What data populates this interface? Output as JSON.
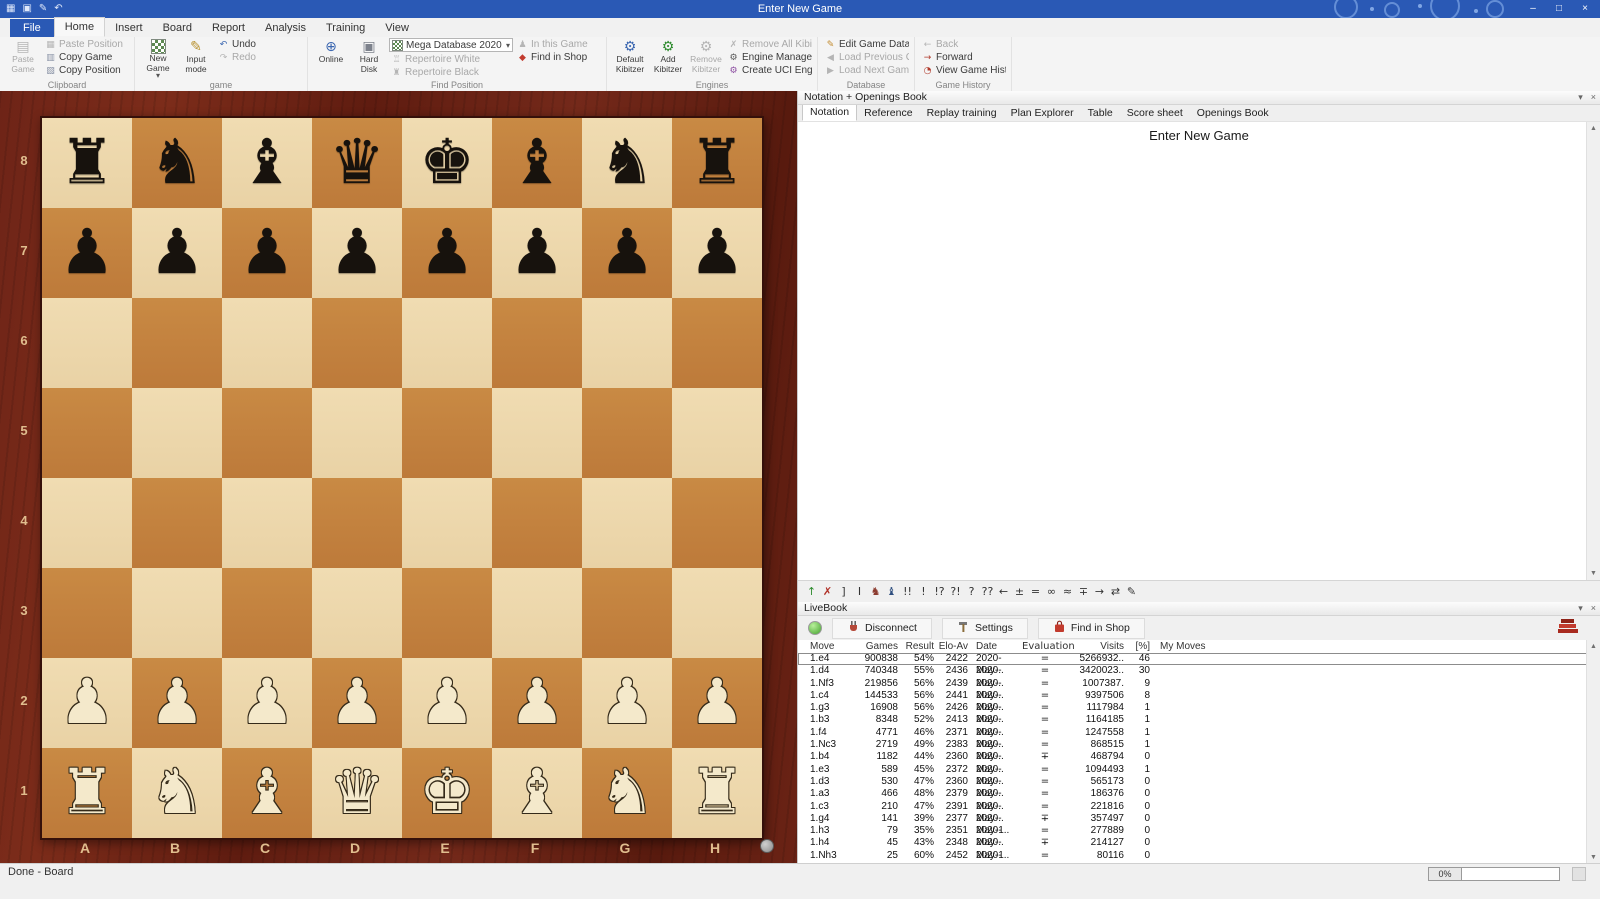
{
  "titlebar": {
    "title": "Enter New Game",
    "quick_access": [
      {
        "name": "board",
        "glyph": "▦"
      },
      {
        "name": "save",
        "glyph": "▣"
      },
      {
        "name": "edit",
        "glyph": "✎"
      },
      {
        "name": "undo",
        "glyph": "↶"
      }
    ],
    "window_buttons": [
      {
        "name": "minimize",
        "glyph": "–"
      },
      {
        "name": "maximize",
        "glyph": "□"
      },
      {
        "name": "close",
        "glyph": "×"
      }
    ]
  },
  "menu": {
    "tabs": [
      {
        "label": "File",
        "style": "file"
      },
      {
        "label": "Home",
        "style": "active"
      },
      {
        "label": "Insert"
      },
      {
        "label": "Board"
      },
      {
        "label": "Report"
      },
      {
        "label": "Analysis"
      },
      {
        "label": "Training"
      },
      {
        "label": "View"
      }
    ]
  },
  "ribbon": {
    "groups": [
      {
        "name": "Clipboard",
        "cols": [
          {
            "type": "big",
            "items": [
              {
                "label": "Paste Game",
                "icon": "clipboard",
                "disabled": true
              }
            ]
          },
          {
            "type": "small",
            "items": [
              {
                "label": "Paste Position",
                "icon": "paste-position",
                "disabled": true
              },
              {
                "label": "Copy Game",
                "icon": "copy-game"
              },
              {
                "label": "Copy Position",
                "icon": "copy-position"
              }
            ]
          }
        ]
      },
      {
        "name": "game",
        "cols": [
          {
            "type": "big",
            "items": [
              {
                "label": "New Game",
                "icon": "chessboard",
                "caret": true
              }
            ]
          },
          {
            "type": "big",
            "items": [
              {
                "label": "Input mode",
                "icon": "pencil"
              }
            ]
          },
          {
            "type": "small",
            "items": [
              {
                "label": "Undo",
                "icon": "undo"
              },
              {
                "label": "Redo",
                "icon": "redo",
                "disabled": true
              }
            ]
          }
        ]
      },
      {
        "name": "Find Position",
        "cols": [
          {
            "type": "big",
            "items": [
              {
                "label": "Online",
                "icon": "globe"
              }
            ]
          },
          {
            "type": "big",
            "items": [
              {
                "label": "Hard Disk",
                "icon": "disk"
              }
            ]
          },
          {
            "type": "smallwide",
            "items": [
              {
                "label": "Mega Database 2020",
                "icon": "chessboard",
                "dropdown": true
              },
              {
                "label": "Repertoire White",
                "icon": "rep-white",
                "disabled": true
              },
              {
                "label": "Repertoire Black",
                "icon": "rep-black",
                "disabled": true
              }
            ]
          },
          {
            "type": "small",
            "items": [
              {
                "label": "In this Game",
                "icon": "in-game",
                "disabled": true
              },
              {
                "label": "Find in Shop",
                "icon": "shop"
              }
            ]
          }
        ]
      },
      {
        "name": "Engines",
        "cols": [
          {
            "type": "big",
            "items": [
              {
                "label": "Default Kibitzer",
                "icon": "kibitzer"
              }
            ]
          },
          {
            "type": "big",
            "items": [
              {
                "label": "Add Kibitzer",
                "icon": "kibitzer-add"
              }
            ]
          },
          {
            "type": "big",
            "items": [
              {
                "label": "Remove Kibitzer",
                "icon": "kibitzer-remove",
                "disabled": true
              }
            ]
          },
          {
            "type": "small",
            "items": [
              {
                "label": "Remove All Kibitzers",
                "icon": "remove-all",
                "disabled": true
              },
              {
                "label": "Engine Management",
                "icon": "engine"
              },
              {
                "label": "Create UCI Engine",
                "icon": "uci"
              }
            ]
          }
        ]
      },
      {
        "name": "Database",
        "cols": [
          {
            "type": "small",
            "items": [
              {
                "label": "Edit Game Data",
                "icon": "edit"
              },
              {
                "label": "Load Previous Game",
                "icon": "prev",
                "disabled": true
              },
              {
                "label": "Load Next Game",
                "icon": "next",
                "disabled": true
              }
            ]
          }
        ]
      },
      {
        "name": "Game History",
        "cols": [
          {
            "type": "small",
            "items": [
              {
                "label": "Back",
                "icon": "back",
                "disabled": true
              },
              {
                "label": "Forward",
                "icon": "forward"
              },
              {
                "label": "View Game History",
                "icon": "history"
              }
            ]
          }
        ]
      }
    ]
  },
  "board": {
    "files": [
      "A",
      "B",
      "C",
      "D",
      "E",
      "F",
      "G",
      "H"
    ],
    "ranks": [
      "8",
      "7",
      "6",
      "5",
      "4",
      "3",
      "2",
      "1"
    ],
    "position": [
      "rnbqkbnr",
      "pppppppp",
      "........",
      "........",
      "........",
      "........",
      "PPPPPPPP",
      "RNBQKBNR"
    ]
  },
  "notation": {
    "panel_title": "Notation + Openings Book",
    "panel_buttons": [
      {
        "name": "collapse",
        "glyph": "▾"
      },
      {
        "name": "close",
        "glyph": "×"
      }
    ],
    "tabs": [
      {
        "label": "Notation",
        "active": true
      },
      {
        "label": "Reference"
      },
      {
        "label": "Replay training"
      },
      {
        "label": "Plan Explorer"
      },
      {
        "label": "Table"
      },
      {
        "label": "Score sheet"
      },
      {
        "label": "Openings Book"
      }
    ],
    "content_title": "Enter New Game"
  },
  "annotations": {
    "symbols": [
      {
        "glyph": "↑",
        "color": "#2e8b2e"
      },
      {
        "glyph": "✗",
        "color": "#b03026"
      },
      {
        "glyph": "]"
      },
      {
        "glyph": "I"
      },
      {
        "glyph": "♞",
        "color": "#8b3a2e"
      },
      {
        "glyph": "♝",
        "color": "#2f4f7f"
      },
      {
        "glyph": "!!"
      },
      {
        "glyph": "!"
      },
      {
        "glyph": "!?"
      },
      {
        "glyph": "?!"
      },
      {
        "glyph": "?"
      },
      {
        "glyph": "??"
      },
      {
        "glyph": "←"
      },
      {
        "glyph": "±"
      },
      {
        "glyph": "="
      },
      {
        "glyph": "∞"
      },
      {
        "glyph": "≈"
      },
      {
        "glyph": "∓"
      },
      {
        "glyph": "→"
      },
      {
        "glyph": "⇄"
      },
      {
        "glyph": "✎"
      }
    ]
  },
  "livebook": {
    "panel_title": "LiveBook",
    "panel_buttons": [
      {
        "name": "collapse",
        "glyph": "▾"
      },
      {
        "name": "close",
        "glyph": "×"
      }
    ],
    "toolbar_buttons": [
      {
        "label": "Disconnect",
        "icon": "plug"
      },
      {
        "label": "Settings",
        "icon": "wrench"
      },
      {
        "label": "Find in Shop",
        "icon": "shop"
      }
    ],
    "columns": [
      "Move",
      "Games",
      "Result",
      "Elo-Av",
      "Date",
      "Evaluation",
      "Visits",
      "[%]",
      "My Moves"
    ],
    "rows": [
      {
        "move": "1.e4",
        "games": "900838",
        "result": "54%",
        "elo": "2422",
        "date": "2020-May-..",
        "eval": "=",
        "visits": "5266932..",
        "pct": "46",
        "my": "",
        "selected": true
      },
      {
        "move": "1.d4",
        "games": "740348",
        "result": "55%",
        "elo": "2436",
        "date": "2020-May-..",
        "eval": "=",
        "visits": "3420023..",
        "pct": "30",
        "my": ""
      },
      {
        "move": "1.Nf3",
        "games": "219856",
        "result": "56%",
        "elo": "2439",
        "date": "2020-May-..",
        "eval": "=",
        "visits": "1007387.",
        "pct": "9",
        "my": ""
      },
      {
        "move": "1.c4",
        "games": "144533",
        "result": "56%",
        "elo": "2441",
        "date": "2020-May-..",
        "eval": "=",
        "visits": "9397506",
        "pct": "8",
        "my": ""
      },
      {
        "move": "1.g3",
        "games": "16908",
        "result": "56%",
        "elo": "2426",
        "date": "2020-May-..",
        "eval": "=",
        "visits": "1117984",
        "pct": "1",
        "my": ""
      },
      {
        "move": "1.b3",
        "games": "8348",
        "result": "52%",
        "elo": "2413",
        "date": "2020-May-..",
        "eval": "=",
        "visits": "1164185",
        "pct": "1",
        "my": ""
      },
      {
        "move": "1.f4",
        "games": "4771",
        "result": "46%",
        "elo": "2371",
        "date": "2020-May-..",
        "eval": "=",
        "visits": "1247558",
        "pct": "1",
        "my": ""
      },
      {
        "move": "1.Nc3",
        "games": "2719",
        "result": "49%",
        "elo": "2383",
        "date": "2020-May-..",
        "eval": "=",
        "visits": "868515",
        "pct": "1",
        "my": ""
      },
      {
        "move": "1.b4",
        "games": "1182",
        "result": "44%",
        "elo": "2360",
        "date": "2020-May-..",
        "eval": "∓",
        "visits": "468794",
        "pct": "0",
        "my": ""
      },
      {
        "move": "1.e3",
        "games": "589",
        "result": "45%",
        "elo": "2372",
        "date": "2020-May-..",
        "eval": "=",
        "visits": "1094493",
        "pct": "1",
        "my": ""
      },
      {
        "move": "1.d3",
        "games": "530",
        "result": "47%",
        "elo": "2360",
        "date": "2020-May-..",
        "eval": "=",
        "visits": "565173",
        "pct": "0",
        "my": ""
      },
      {
        "move": "1.a3",
        "games": "466",
        "result": "48%",
        "elo": "2379",
        "date": "2020-May-..",
        "eval": "=",
        "visits": "186376",
        "pct": "0",
        "my": ""
      },
      {
        "move": "1.c3",
        "games": "210",
        "result": "47%",
        "elo": "2391",
        "date": "2020-May-..",
        "eval": "=",
        "visits": "221816",
        "pct": "0",
        "my": ""
      },
      {
        "move": "1.g4",
        "games": "141",
        "result": "39%",
        "elo": "2377",
        "date": "2020-May-1..",
        "eval": "∓",
        "visits": "357497",
        "pct": "0",
        "my": ""
      },
      {
        "move": "1.h3",
        "games": "79",
        "result": "35%",
        "elo": "2351",
        "date": "2020-May-..",
        "eval": "=",
        "visits": "277889",
        "pct": "0",
        "my": ""
      },
      {
        "move": "1.h4",
        "games": "45",
        "result": "43%",
        "elo": "2348",
        "date": "2020-May-1..",
        "eval": "∓",
        "visits": "214127",
        "pct": "0",
        "my": ""
      },
      {
        "move": "1.Nh3",
        "games": "25",
        "result": "60%",
        "elo": "2452",
        "date": "2020-May-..",
        "eval": "=",
        "visits": "80116",
        "pct": "0",
        "my": ""
      }
    ]
  },
  "statusbar": {
    "left": "Done - Board",
    "progress": "0%"
  }
}
